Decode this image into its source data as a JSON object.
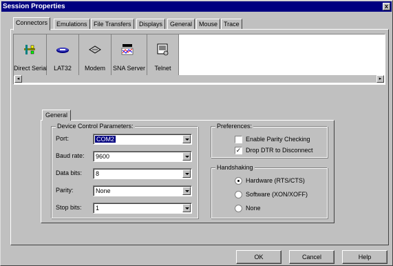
{
  "window": {
    "title": "Session Properties",
    "close_glyph": "x"
  },
  "tabs": [
    "Connectors",
    "Emulations",
    "File Transfers",
    "Displays",
    "General",
    "Mouse",
    "Trace"
  ],
  "connectors": [
    {
      "label": "Direct Serial",
      "icon": "serial-cable-icon"
    },
    {
      "label": "LAT32",
      "icon": "lat-icon"
    },
    {
      "label": "Modem",
      "icon": "modem-icon"
    },
    {
      "label": "SNA Server",
      "icon": "sna-server-icon"
    },
    {
      "label": "Telnet",
      "icon": "telnet-icon"
    }
  ],
  "inner_tab": "General",
  "device_control": {
    "title": "Device Control Parameters:",
    "fields": [
      {
        "label": "Port:",
        "value": "COM2"
      },
      {
        "label": "Baud rate:",
        "value": "9600"
      },
      {
        "label": "Data bits:",
        "value": "8"
      },
      {
        "label": "Parity:",
        "value": "None"
      },
      {
        "label": "Stop bits:",
        "value": "1"
      }
    ]
  },
  "preferences": {
    "title": "Preferences:",
    "options": [
      {
        "label": "Enable Parity Checking",
        "checked": false
      },
      {
        "label": "Drop DTR to Disconnect",
        "checked": true
      }
    ],
    "check_glyph": "✓"
  },
  "handshaking": {
    "title": "Handshaking",
    "options": [
      {
        "label": "Hardware (RTS/CTS)",
        "selected": true
      },
      {
        "label": "Software (XON/XOFF)",
        "selected": false
      },
      {
        "label": "None",
        "selected": false
      }
    ]
  },
  "buttons": {
    "ok": "OK",
    "cancel": "Cancel",
    "help": "Help"
  },
  "scroll": {
    "left_glyph": "◂",
    "right_glyph": "▸"
  }
}
